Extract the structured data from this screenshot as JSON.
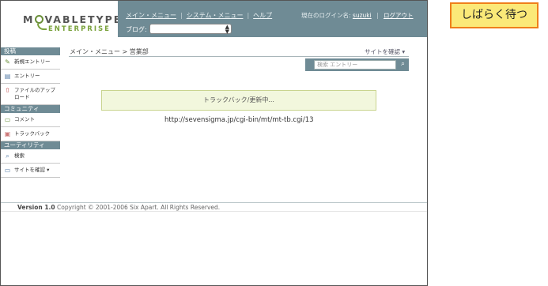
{
  "logo": {
    "main": "MOVABLETYPE",
    "tm": "TM",
    "edition": "ENTERPRISE"
  },
  "topnav": {
    "main_menu": "メイン・メニュー",
    "system_menu": "システム・メニュー",
    "help": "ヘルプ",
    "separator": "|"
  },
  "user": {
    "logged_in_label": "現在のログイン名:",
    "username": "suzuki",
    "logout": "ログアウト"
  },
  "blog_selector": {
    "label": "ブログ:",
    "value": ""
  },
  "sidebar": {
    "sections": [
      {
        "title": "投稿",
        "items": [
          {
            "label": "新規エントリー",
            "icon": "new-entry-icon"
          },
          {
            "label": "エントリー",
            "icon": "entries-icon"
          },
          {
            "label": "ファイルのアップロード",
            "icon": "upload-icon"
          }
        ]
      },
      {
        "title": "コミュニティ",
        "items": [
          {
            "label": "コメント",
            "icon": "comment-icon"
          },
          {
            "label": "トラックバック",
            "icon": "trackback-icon"
          }
        ]
      },
      {
        "title": "ユーティリティ",
        "items": [
          {
            "label": "検索",
            "icon": "search-icon"
          },
          {
            "label": "サイトを確認 ▾",
            "icon": "view-site-icon"
          }
        ]
      }
    ]
  },
  "breadcrumb": "メイン・メニュー > 営業部",
  "view_site_link": "サイトを確認 ▾",
  "search": {
    "placeholder": "検索 エントリー"
  },
  "status_message": "トラックバック/更新中...",
  "ping_url": "http://sevensigma.jp/cgi-bin/mt/mt-tb.cgi/13",
  "footer": {
    "version": "Version 1.0",
    "copyright": "Copyright © 2001-2006 Six Apart. All Rights Reserved."
  },
  "callout": "しばらく待つ",
  "colors": {
    "header": "#6f8b95",
    "accent_green": "#7aa23c",
    "status_bg": "#f2f7dd",
    "callout_bg": "#fbe978",
    "callout_border": "#ef7f1a"
  }
}
